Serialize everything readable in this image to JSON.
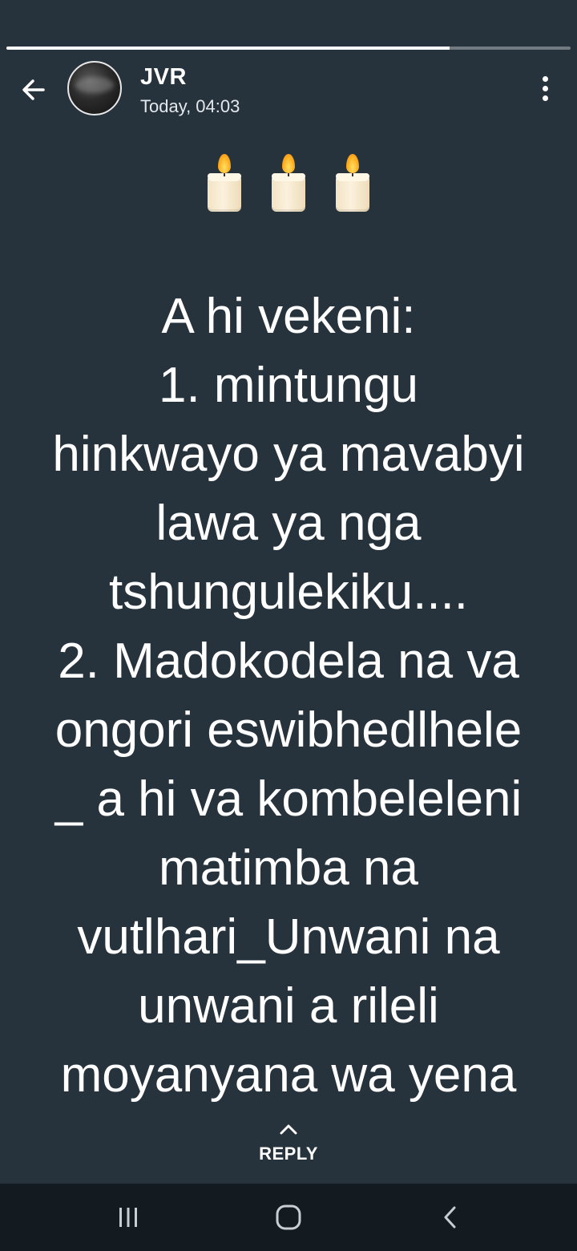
{
  "status": {
    "progress": [
      0.785
    ]
  },
  "header": {
    "sender": "JVR",
    "timestamp": "Today, 04:03",
    "back_icon": "arrow-left-icon",
    "menu_icon": "more-vertical-icon"
  },
  "status_content": {
    "emoji": [
      "candle",
      "candle",
      "candle"
    ],
    "text": "A hi vekeni:\n1. mintungu\nhinkwayo ya mavabyi\nlawa ya nga\ntshungulekiku.... \n2. Madokodela na va\nongori eswibhedlhele\n_ a hi va kombeleleni\nmatimba na\nvutlhari_Unwani na\nunwani a rileli\nmoyanyana wa yena"
  },
  "reply": {
    "label": "REPLY",
    "icon": "chevron-up-icon"
  },
  "navbar": {
    "recents_icon": "recents-icon",
    "home_icon": "home-icon",
    "back_icon": "nav-back-icon"
  },
  "colors": {
    "background": "#26333d",
    "navbar": "#141b20",
    "text": "#ffffff"
  }
}
